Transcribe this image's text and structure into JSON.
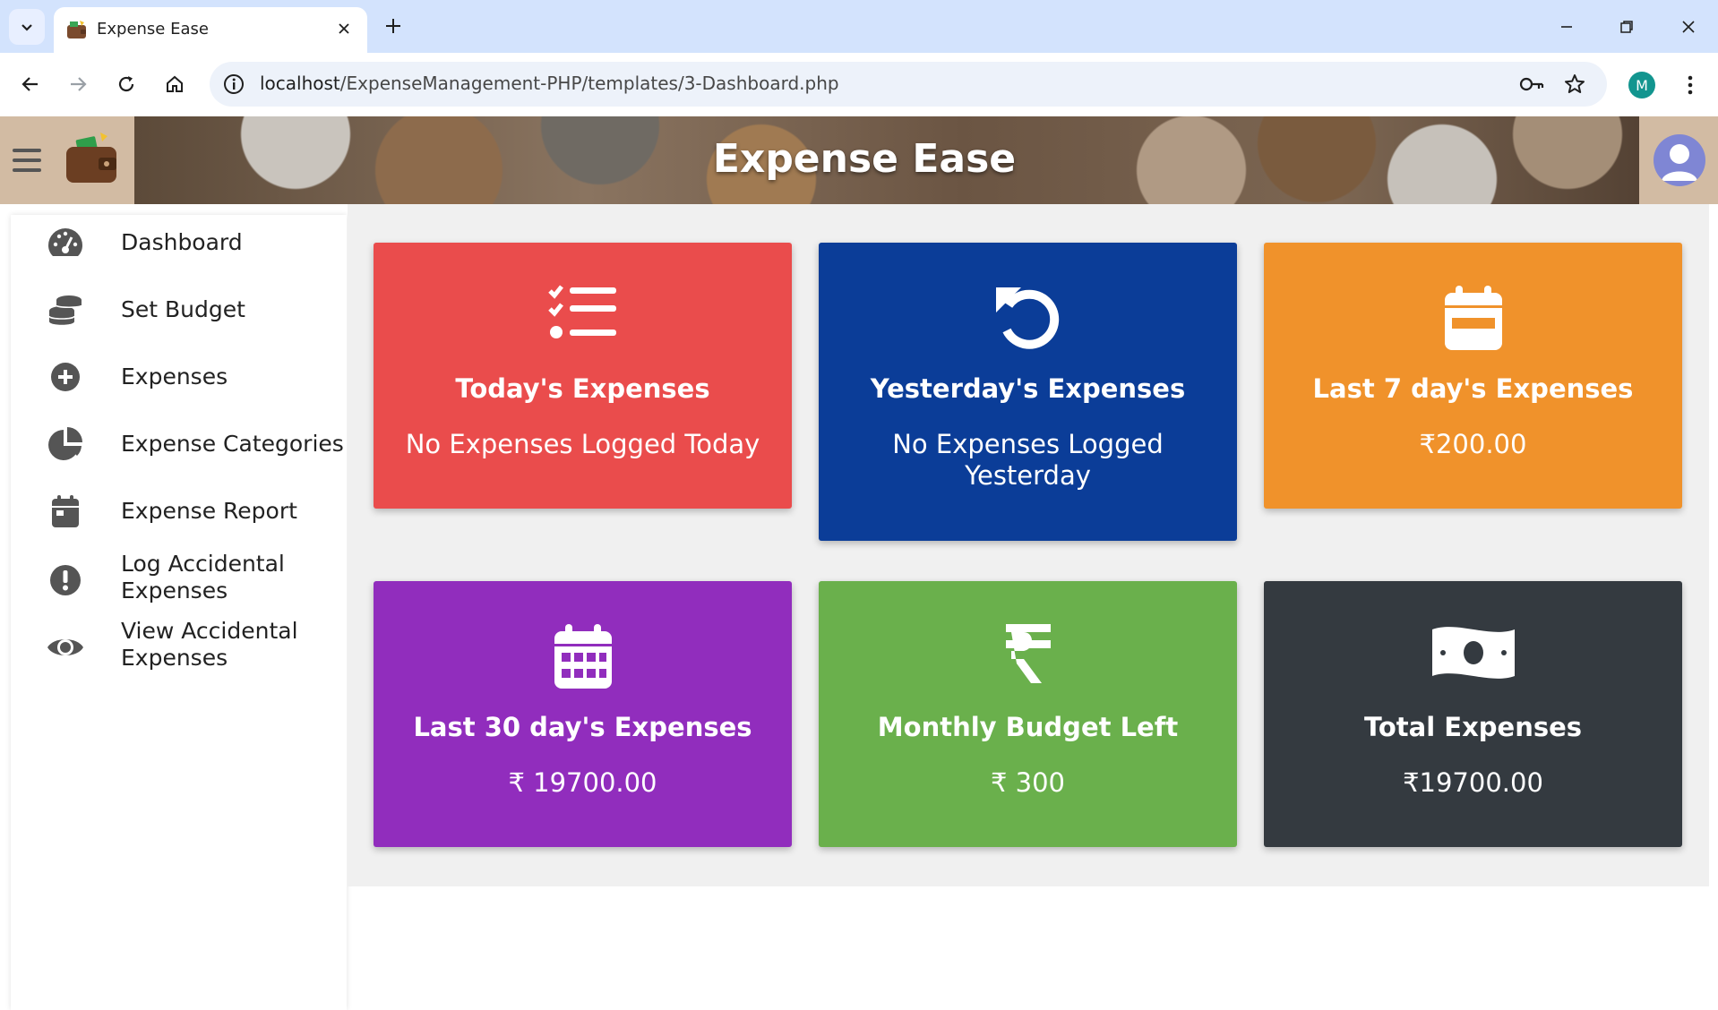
{
  "browser": {
    "tab_title": "Expense Ease",
    "url_host": "localhost",
    "url_path": "/ExpenseManagement-PHP/templates/3-Dashboard.php",
    "profile_initial": "M"
  },
  "header": {
    "title": "Expense Ease"
  },
  "sidebar": {
    "items": [
      {
        "label": "Dashboard",
        "icon": "gauge-icon"
      },
      {
        "label": "Set Budget",
        "icon": "coins-icon"
      },
      {
        "label": "Expenses",
        "icon": "plus-circle-icon"
      },
      {
        "label": "Expense Categories",
        "icon": "pie-chart-icon"
      },
      {
        "label": "Expense Report",
        "icon": "calendar-icon"
      },
      {
        "label": "Log Accidental Expenses",
        "icon": "exclamation-circle-icon"
      },
      {
        "label": "View Accidental Expenses",
        "icon": "eye-icon"
      }
    ]
  },
  "cards": [
    {
      "title": "Today's Expenses",
      "value": "No Expenses Logged Today",
      "color": "#ea4c4c",
      "icon": "tasks-icon"
    },
    {
      "title": "Yesterday's Expenses",
      "value": "No Expenses Logged Yesterday",
      "color": "#0b3d98",
      "icon": "undo-icon"
    },
    {
      "title": "Last 7 day's Expenses",
      "value": "₹200.00",
      "color": "#f0922b",
      "icon": "calendar-week-icon"
    },
    {
      "title": "Last 30 day's Expenses",
      "value": "₹ 19700.00",
      "color": "#912dbd",
      "icon": "calendar-month-icon"
    },
    {
      "title": "Monthly Budget Left",
      "value": "₹ 300",
      "color": "#6ab04c",
      "icon": "rupee-icon"
    },
    {
      "title": "Total Expenses",
      "value": "₹19700.00",
      "color": "#343a40",
      "icon": "money-bill-icon"
    }
  ]
}
